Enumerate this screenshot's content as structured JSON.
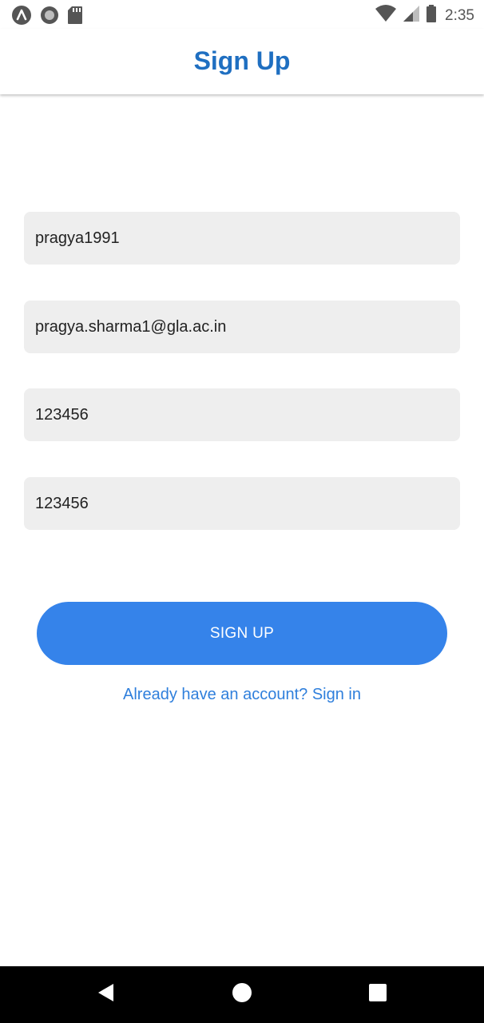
{
  "status_bar": {
    "time": "2:35",
    "left_icons": [
      "app-a-icon",
      "record-icon",
      "sd-card-icon"
    ],
    "right_icons": [
      "wifi-icon",
      "cell-signal-icon",
      "battery-icon"
    ]
  },
  "header": {
    "title": "Sign Up",
    "title_color": "#1f6fc1"
  },
  "form": {
    "username_value": "pragya1991",
    "email_value": "pragya.sharma1@gla.ac.in",
    "password_value": "123456",
    "confirm_password_value": "123456",
    "field_background": "#eeeeee"
  },
  "actions": {
    "signup_label": "SIGN UP",
    "signup_color": "#3583ea",
    "signin_link": "Already have an account? Sign in",
    "link_color": "#2f7fdc"
  },
  "nav_bar": {
    "icons": [
      "back-icon",
      "home-icon",
      "recents-icon"
    ]
  }
}
